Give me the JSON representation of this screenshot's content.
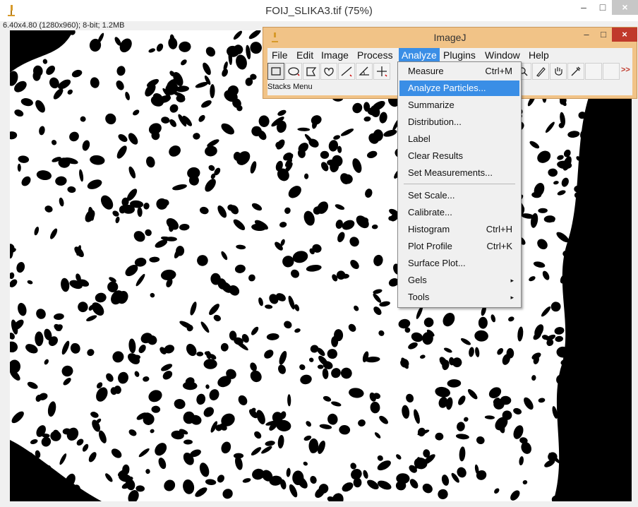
{
  "window": {
    "title": "FOIJ_SLIKA3.tif (75%)",
    "info": "6.40x4.80  (1280x960); 8-bit; 1.2MB",
    "minimize": "–",
    "maximize": "□",
    "close": "×"
  },
  "imagej": {
    "title": "ImageJ",
    "minimize": "–",
    "maximize": "□",
    "close": "×",
    "menus": [
      "File",
      "Edit",
      "Image",
      "Process",
      "Analyze",
      "Plugins",
      "Window",
      "Help"
    ],
    "active_menu": "Analyze",
    "status": "Stacks Menu",
    "more": ">>",
    "tools": [
      "rectangle-tool",
      "oval-tool",
      "polygon-tool",
      "freehand-tool",
      "line-tool",
      "angle-tool",
      "point-tool",
      "wand-tool",
      "text-tool",
      "hand-tool",
      "color-picker-tool"
    ]
  },
  "analyze_menu": {
    "items": [
      {
        "label": "Measure",
        "shortcut": "Ctrl+M"
      },
      {
        "label": "Analyze Particles...",
        "shortcut": "",
        "highlighted": true
      },
      {
        "label": "Summarize",
        "shortcut": ""
      },
      {
        "label": "Distribution...",
        "shortcut": ""
      },
      {
        "label": "Label",
        "shortcut": ""
      },
      {
        "label": "Clear Results",
        "shortcut": ""
      },
      {
        "label": "Set Measurements...",
        "shortcut": ""
      },
      {
        "label": "Set Scale...",
        "shortcut": ""
      },
      {
        "label": "Calibrate...",
        "shortcut": ""
      },
      {
        "label": "Histogram",
        "shortcut": "Ctrl+H"
      },
      {
        "label": "Plot Profile",
        "shortcut": "Ctrl+K"
      },
      {
        "label": "Surface Plot...",
        "shortcut": ""
      },
      {
        "label": "Gels",
        "shortcut": "",
        "submenu": true
      },
      {
        "label": "Tools",
        "shortcut": "",
        "submenu": true
      }
    ]
  },
  "colors": {
    "imagej_frame": "#f1c387",
    "highlight": "#3a8ee6",
    "close_button": "#c0392b"
  }
}
